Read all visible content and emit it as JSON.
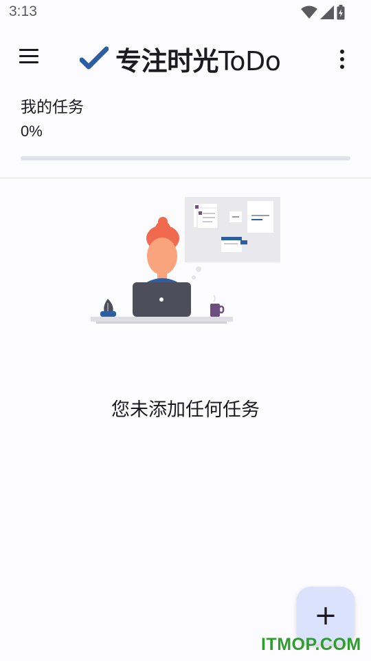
{
  "status_bar": {
    "time": "3:13",
    "icons": [
      "wifi-icon",
      "signal-icon",
      "battery-charging-icon"
    ]
  },
  "app_bar": {
    "title_cn": "专注时光",
    "title_en": "ToDo",
    "menu_icon": "menu-icon",
    "more_icon": "more-vert-icon",
    "logo_icon": "check-icon",
    "accent_color": "#2d5fa0"
  },
  "tasks": {
    "section_label": "我的任务",
    "progress_text": "0%",
    "progress_value": 0
  },
  "empty_state": {
    "message": "您未添加任何任务"
  },
  "fab": {
    "label": "+",
    "icon": "add-icon"
  },
  "watermark": "ITMOP.COM"
}
